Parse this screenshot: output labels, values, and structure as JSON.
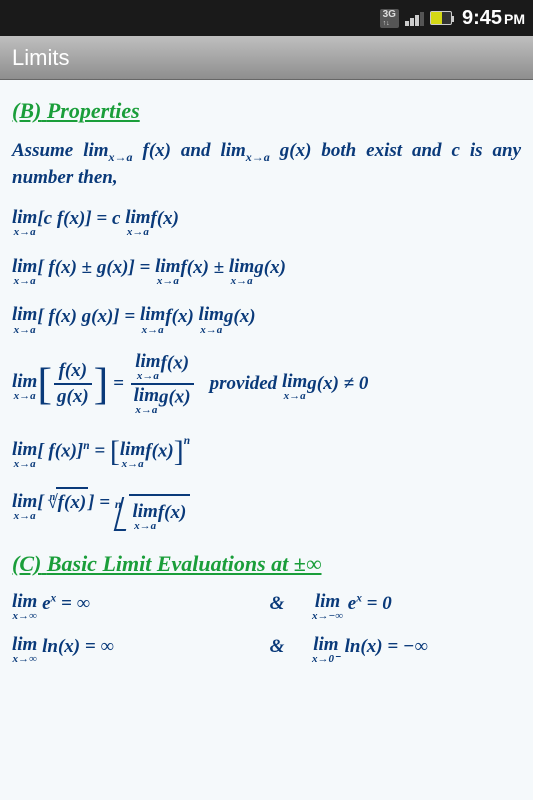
{
  "status": {
    "network": "3G",
    "arrow": "↑↓",
    "time": "9:45",
    "period": "PM"
  },
  "app": {
    "title": "Limits"
  },
  "sectionB": {
    "label": "(B)",
    "title": "Properties"
  },
  "intro": {
    "t1": "Assume  ",
    "t2": " f(x)  and  ",
    "t3": " g(x)  both  exist and c is any number then,"
  },
  "lim": {
    "top": "lim",
    "xa": "x→a",
    "xpi": "x→∞",
    "xni": "x→−∞",
    "x0m": "x→0⁻"
  },
  "f": {
    "p1_lhs": "[c f(x)] = c ",
    "p1_rhs": "f(x)",
    "p2_lhs": "[ f(x) ± g(x)] = ",
    "p2_m": "f(x) ± ",
    "p2_rhs": "g(x)",
    "p3_lhs": "[ f(x) g(x)] = ",
    "p3_m": "f(x) ",
    "p3_rhs": "g(x)",
    "p4_num": "f(x)",
    "p4_den": "g(x)",
    "p4_eq": " = ",
    "p4_rnum": "f(x)",
    "p4_rden": "g(x)",
    "p4_prov": "provided  ",
    "p4_ne": "g(x) ≠ 0",
    "p5_l": "[ f(x)]",
    "p5_exp": "n",
    "p5_eq": " = ",
    "p5_inner": "f(x)",
    "p6_fx": "f(x)",
    "p6_rhs": " = "
  },
  "sectionC": {
    "label": "(C)",
    "title": "Basic Limit Evaluations at ±∞"
  },
  "ev": {
    "amp": "&",
    "r1a_body": " e",
    "r1a_sup": "x",
    "r1a_eq": " = ∞",
    "r1b_body": " e",
    "r1b_sup": "x",
    "r1b_eq": " = 0",
    "r2a": " ln(x) = ∞",
    "r2b": " ln(x) = −∞"
  }
}
